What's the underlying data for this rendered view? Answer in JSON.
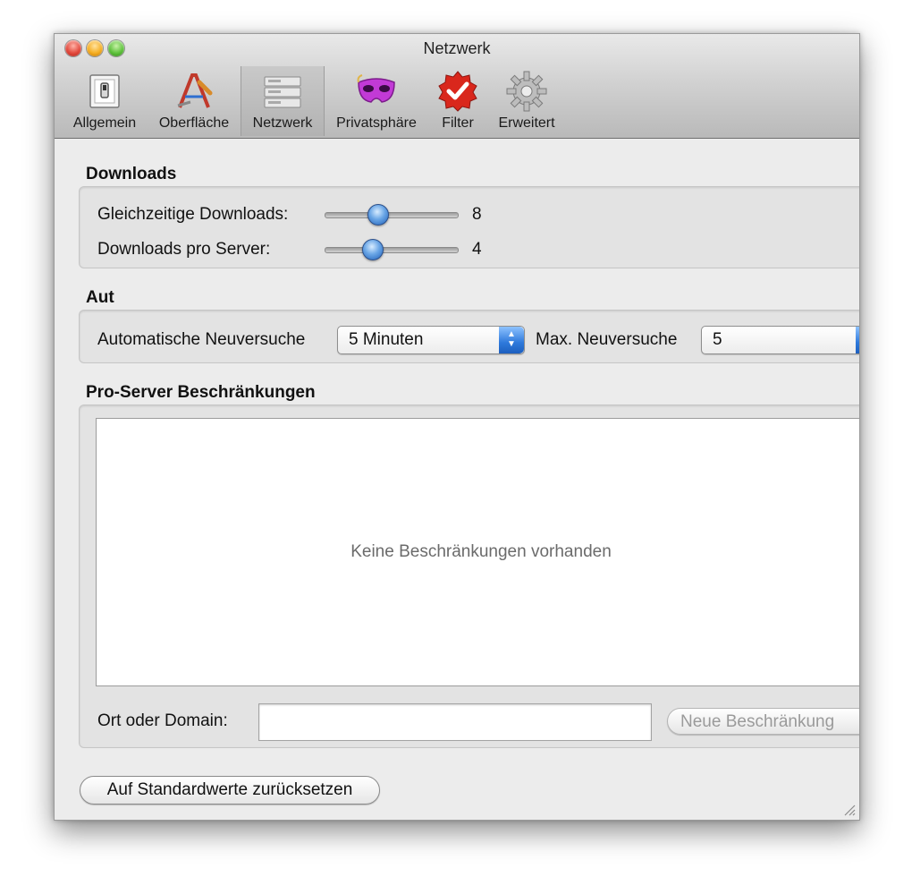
{
  "window": {
    "title": "Netzwerk"
  },
  "toolbar": {
    "tabs": [
      {
        "label": "Allgemein",
        "icon": "switch-icon"
      },
      {
        "label": "Oberfläche",
        "icon": "appearance-icon"
      },
      {
        "label": "Netzwerk",
        "icon": "network-icon",
        "selected": true
      },
      {
        "label": "Privatsphäre",
        "icon": "mask-icon"
      },
      {
        "label": "Filter",
        "icon": "filter-badge-icon"
      },
      {
        "label": "Erweitert",
        "icon": "gear-icon"
      }
    ]
  },
  "downloads": {
    "title": "Downloads",
    "concurrent_label": "Gleichzeitige Downloads:",
    "concurrent_value": "8",
    "per_server_label": "Downloads pro Server:",
    "per_server_value": "4"
  },
  "auto": {
    "title": "Aut",
    "retry_label": "Automatische Neuversuche",
    "retry_value": "5 Minuten",
    "max_label": "Max. Neuversuche",
    "max_value": "5"
  },
  "restrictions": {
    "title": "Pro-Server Beschränkungen",
    "empty_text": "Keine Beschränkungen vorhanden",
    "domain_label": "Ort oder Domain:",
    "domain_value": "",
    "new_button": "Neue Beschränkung"
  },
  "footer": {
    "reset_button": "Auf Standardwerte zurücksetzen"
  },
  "colors": {
    "accent": "#2e79db",
    "window_bg": "#ececec"
  }
}
